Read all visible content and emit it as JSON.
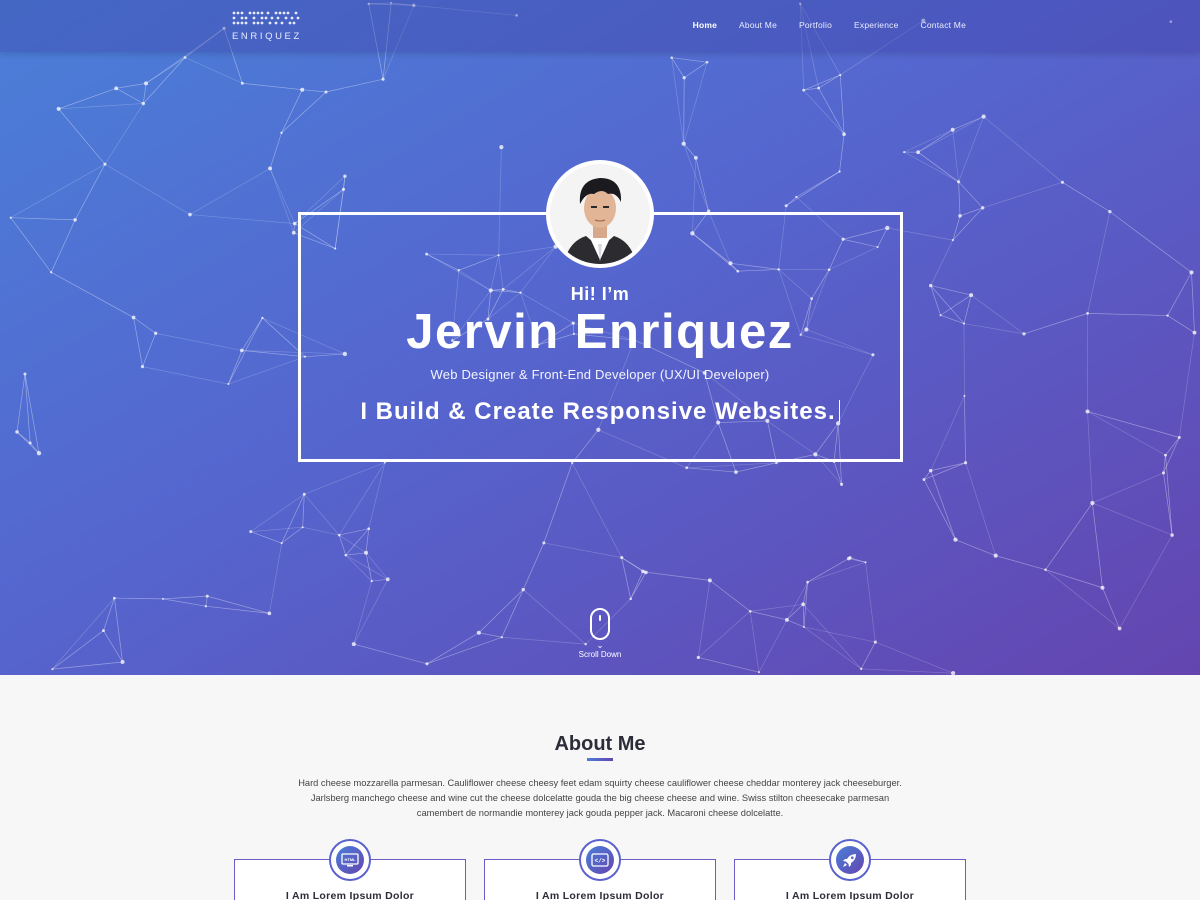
{
  "brand": {
    "logo_text": "ENRIQUEZ"
  },
  "nav": {
    "items": [
      {
        "label": "Home",
        "active": true
      },
      {
        "label": "About Me",
        "active": false
      },
      {
        "label": "Portfolio",
        "active": false
      },
      {
        "label": "Experience",
        "active": false
      },
      {
        "label": "Contact Me",
        "active": false
      }
    ]
  },
  "hero": {
    "greeting": "Hi! I’m",
    "name": "Jervin Enriquez",
    "role": "Web Designer & Front-End Developer  (UX/UI Developer)",
    "tagline": "I Build & Create Responsive Websites.",
    "scroll_label": "Scroll Down"
  },
  "about": {
    "title": "About Me",
    "paragraph": "Hard cheese mozzarella parmesan. Cauliflower cheese cheesy feet edam squirty cheese cauliflower cheese cheddar monterey jack cheeseburger. Jarlsberg manchego cheese and wine cut the cheese dolcelatte gouda the big cheese cheese and wine. Swiss stilton cheesecake parmesan camembert de normandie monterey jack gouda pepper jack. Macaroni cheese dolcelatte.",
    "cards": [
      {
        "title": "I Am Lorem Ipsum Dolor",
        "icon": "html-icon",
        "icon_text": "HTML"
      },
      {
        "title": "I Am Lorem Ipsum Dolor",
        "icon": "code-icon",
        "icon_text": "</>"
      },
      {
        "title": "I Am Lorem Ipsum Dolor",
        "icon": "rocket-icon",
        "icon_text": ""
      }
    ]
  },
  "colors": {
    "gradient_start": "#4a7fd8",
    "gradient_end": "#6445b0",
    "accent": "#5b61cf"
  }
}
